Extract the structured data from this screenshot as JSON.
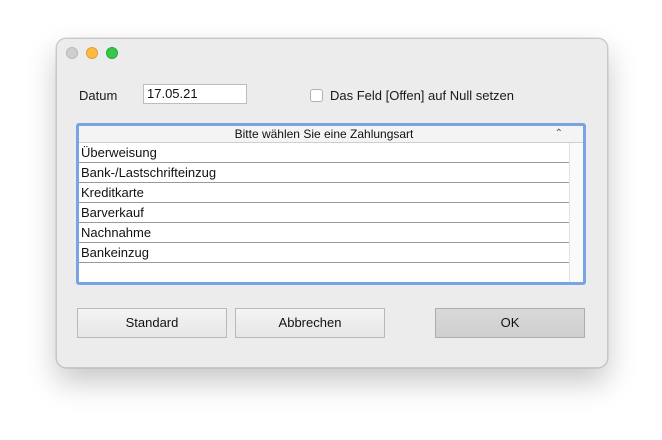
{
  "window": {
    "title": ""
  },
  "form": {
    "date_label": "Datum",
    "date_value": "17.05.21",
    "checkbox_label": "Das Feld [Offen] auf Null setzen",
    "checkbox_checked": false
  },
  "list": {
    "header": "Bitte wählen Sie eine Zahlungsart",
    "sort_icon": "chevron-up-icon",
    "items": [
      "Überweisung",
      "Bank-/Lastschrifteinzug",
      "Kreditkarte",
      "Barverkauf",
      "Nachnahme",
      "Bankeinzug"
    ],
    "focus_color": "#7aa3e5"
  },
  "buttons": {
    "standard": "Standard",
    "cancel": "Abbrechen",
    "ok": "OK"
  },
  "colors": {
    "close": "#cfcfcf",
    "minimize": "#fdbc40",
    "zoom": "#34c84a"
  }
}
